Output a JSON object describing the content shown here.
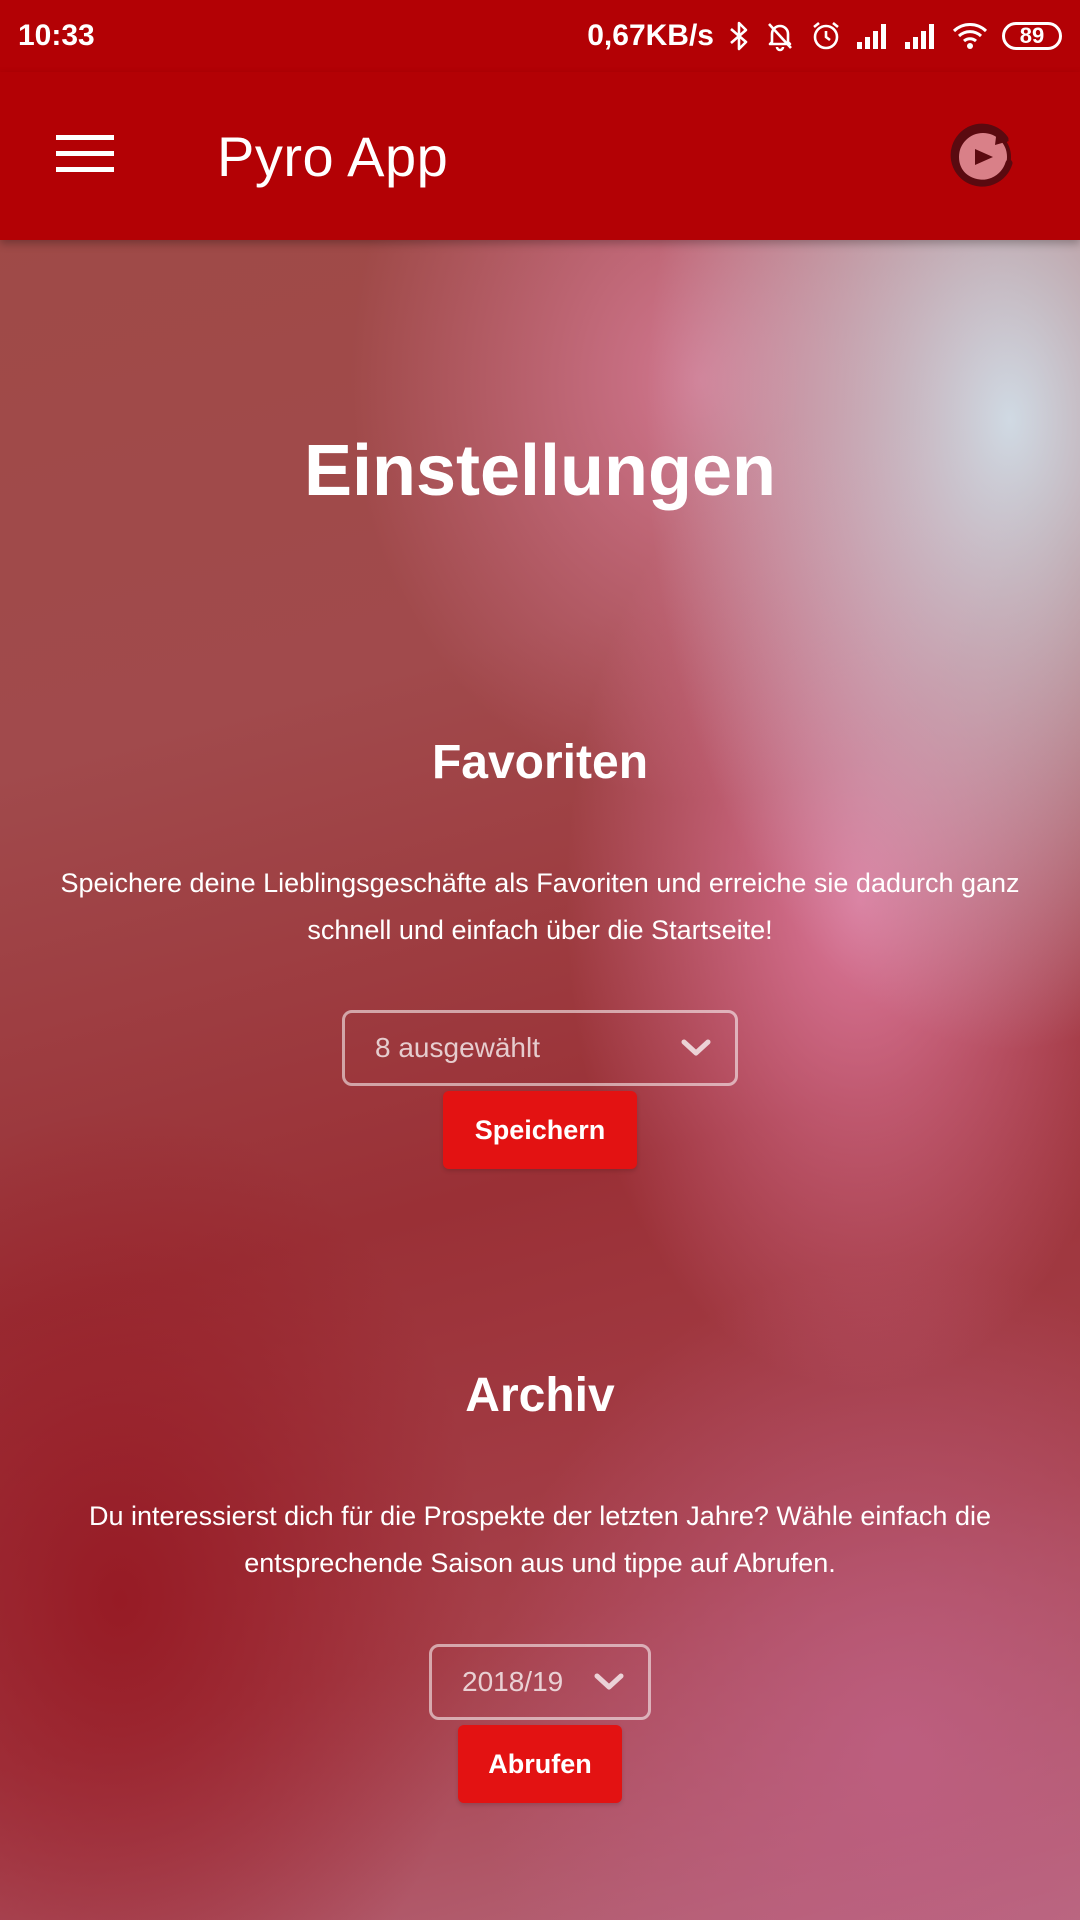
{
  "status_bar": {
    "time": "10:33",
    "network_speed": "0,67KB/s",
    "battery": "89",
    "icons": [
      "bluetooth-icon",
      "mute-bell-icon",
      "alarm-icon",
      "signal-icon",
      "signal-icon",
      "wifi-icon",
      "battery-icon"
    ]
  },
  "app_bar": {
    "title": "Pyro App",
    "menu_icon": "hamburger-menu-icon",
    "refresh_icon": "refresh-icon"
  },
  "page": {
    "title": "Einstellungen"
  },
  "favorites": {
    "title": "Favoriten",
    "description": "Speichere deine Lieblingsgeschäfte als Favoriten und erreiche sie dadurch ganz schnell und einfach über die Startseite!",
    "select_value": "8 ausgewählt",
    "button_label": "Speichern"
  },
  "archive": {
    "title": "Archiv",
    "description": "Du interessierst dich für die Prospekte der letzten Jahre? Wähle einfach die entsprechende Saison aus und tippe auf Abrufen.",
    "select_value": "2018/19",
    "button_label": "Abrufen"
  },
  "colors": {
    "primary": "#b30105",
    "button": "#e31212",
    "text": "#ffffff"
  }
}
